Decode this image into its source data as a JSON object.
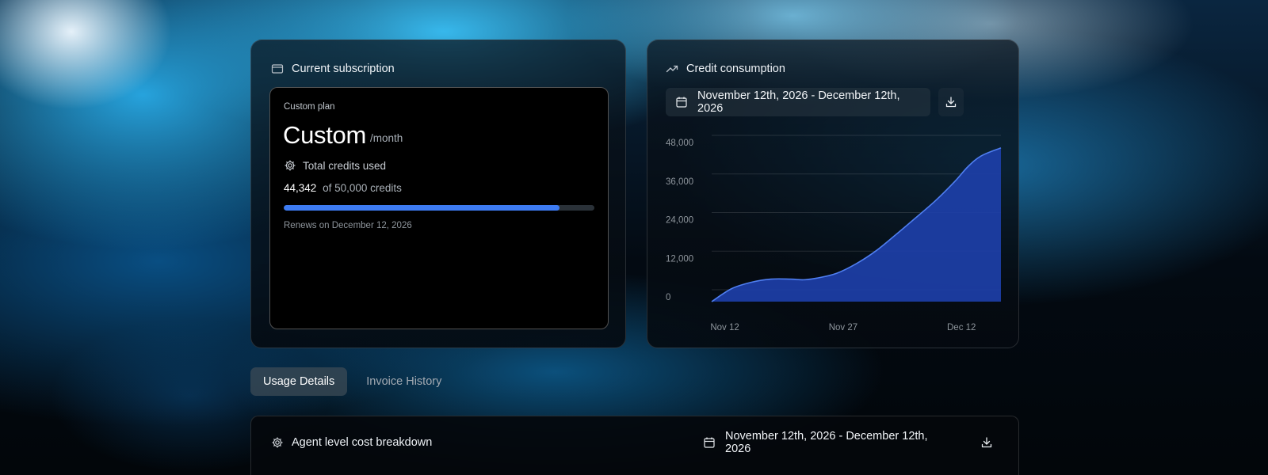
{
  "subscription": {
    "title": "Current subscription",
    "plan_label": "Custom plan",
    "plan_name": "Custom",
    "plan_period": "/month",
    "credits_label": "Total credits used",
    "used": "44,342",
    "of_total": "of 50,000 credits",
    "progress_fraction": 0.8868,
    "renews": "Renews on December 12, 2026"
  },
  "credit_consumption": {
    "title": "Credit consumption",
    "date_range": "November 12th, 2026 - December 12th, 2026"
  },
  "tabs": [
    {
      "label": "Usage Details",
      "active": true
    },
    {
      "label": "Invoice History",
      "active": false
    }
  ],
  "agent_breakdown": {
    "title": "Agent level cost breakdown",
    "date_range": "November 12th, 2026 - December 12th, 2026"
  },
  "colors": {
    "accent": "#3d7bf2",
    "chart_fill": "#1d3fa8",
    "chart_line": "#4f7ef0"
  },
  "icons": {
    "subscription": "credit-card-icon",
    "consumption": "trending-up-icon",
    "calendar": "calendar-icon",
    "download": "download-icon",
    "credits": "gear-icon"
  },
  "chart_data": {
    "type": "area",
    "title": "",
    "xlabel": "",
    "ylabel": "",
    "x": [
      0,
      3,
      6,
      9,
      12,
      14,
      16,
      19,
      22,
      25,
      28,
      31,
      34,
      37,
      39,
      41,
      44
    ],
    "values": [
      0,
      4000,
      6000,
      7000,
      7000,
      6800,
      7300,
      8800,
      11800,
      15800,
      20800,
      26000,
      31300,
      37400,
      42000,
      45300,
      47800
    ],
    "x_ticks": [
      {
        "x": 2,
        "label": "Nov 12"
      },
      {
        "x": 20,
        "label": "Nov 27"
      },
      {
        "x": 38,
        "label": "Dec 12"
      }
    ],
    "y_ticks": [
      0,
      12000,
      24000,
      36000,
      48000
    ],
    "y_tick_labels": [
      "0",
      "12,000",
      "24,000",
      "36,000",
      "48,000"
    ],
    "xlim": [
      0,
      44
    ],
    "ylim": [
      0,
      48000
    ],
    "grid": true,
    "legend": "none"
  }
}
